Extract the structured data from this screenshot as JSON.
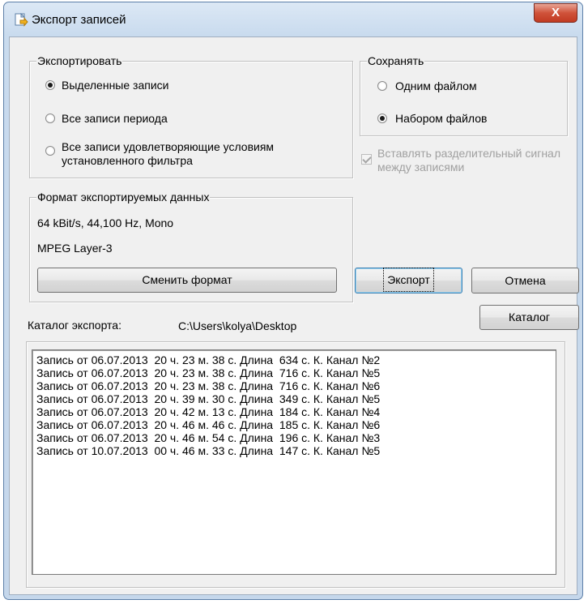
{
  "window": {
    "title": "Экспорт записей",
    "close_label": "X"
  },
  "export_group": {
    "label": "Экспортировать",
    "options": [
      {
        "label": "Выделенные записи",
        "checked": true
      },
      {
        "label": "Все записи периода",
        "checked": false
      },
      {
        "label": "Все записи удовлетворяющие условиям установленного фильтра",
        "checked": false
      }
    ]
  },
  "save_group": {
    "label": "Сохранять",
    "options": [
      {
        "label": "Одним файлом",
        "checked": false
      },
      {
        "label": "Набором файлов",
        "checked": true
      }
    ]
  },
  "separator_checkbox": {
    "label": "Вставлять разделительный сигнал между записями",
    "checked": true,
    "disabled": true
  },
  "format_group": {
    "label": "Формат экспортируемых данных",
    "line1": "64 kBit/s, 44,100 Hz, Mono",
    "line2": "MPEG Layer-3",
    "change_button": "Сменить формат"
  },
  "buttons": {
    "export": "Экспорт",
    "cancel": "Отмена",
    "catalog": "Каталог"
  },
  "catalog": {
    "label": "Каталог экспорта:",
    "path": "C:\\Users\\kolya\\Desktop"
  },
  "records": [
    "Запись от 06.07.2013  20 ч. 23 м. 38 с. Длина  634 с. К. Канал №2",
    "Запись от 06.07.2013  20 ч. 23 м. 38 с. Длина  716 с. К. Канал №5",
    "Запись от 06.07.2013  20 ч. 23 м. 38 с. Длина  716 с. К. Канал №6",
    "Запись от 06.07.2013  20 ч. 39 м. 30 с. Длина  349 с. К. Канал №5",
    "Запись от 06.07.2013  20 ч. 42 м. 13 с. Длина  184 с. К. Канал №4",
    "Запись от 06.07.2013  20 ч. 46 м. 46 с. Длина  185 с. К. Канал №6",
    "Запись от 06.07.2013  20 ч. 46 м. 54 с. Длина  196 с. К. Канал №3",
    "Запись от 10.07.2013  00 ч. 46 м. 33 с. Длина  147 с. К. Канал №5"
  ]
}
